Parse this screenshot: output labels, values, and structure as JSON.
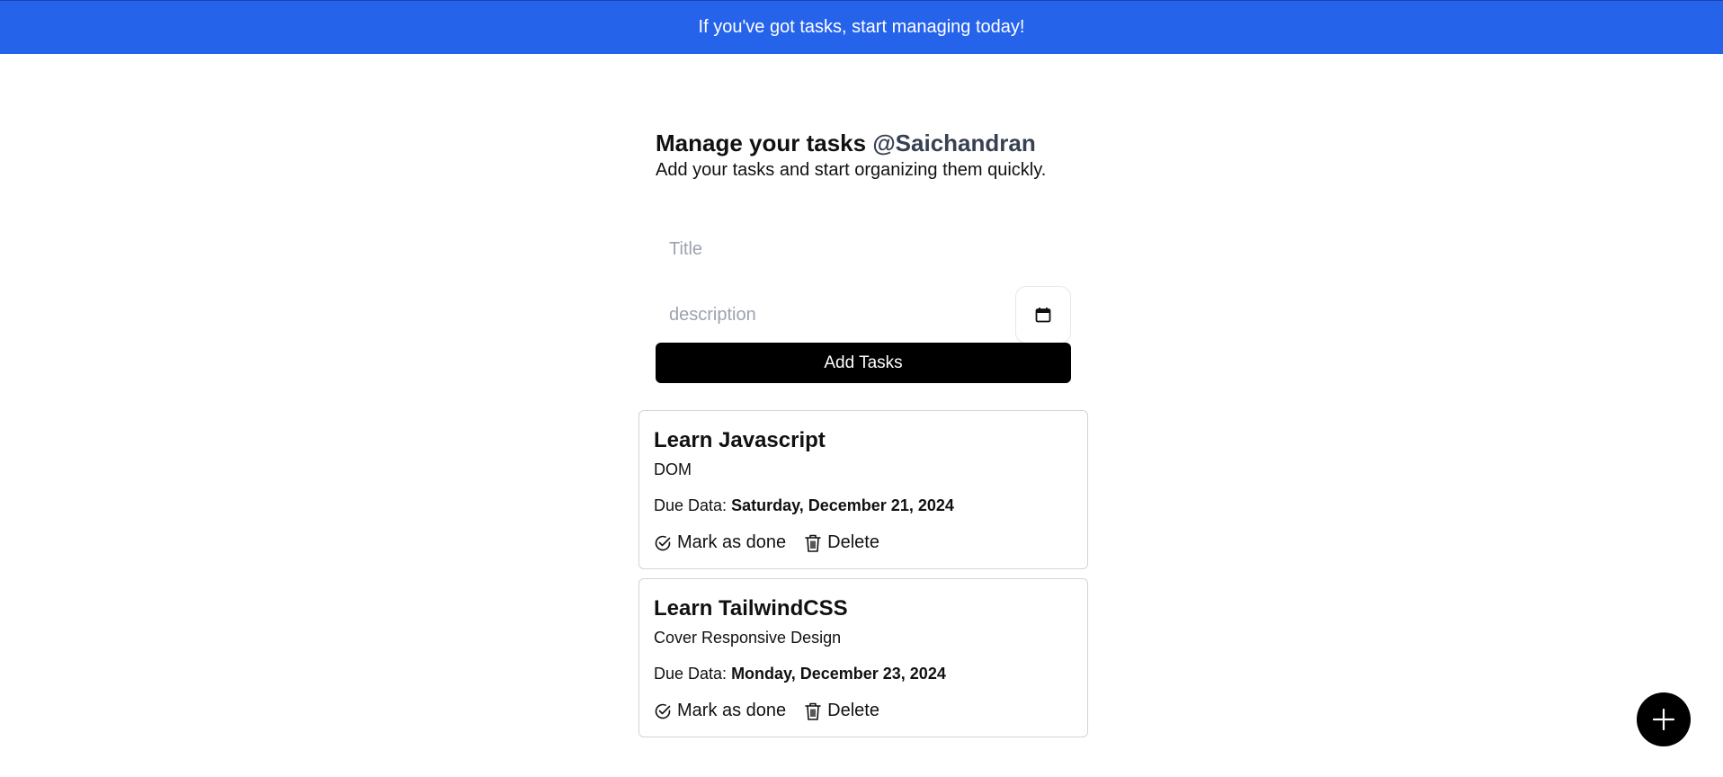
{
  "banner": {
    "text": "If you've got tasks, start managing today!",
    "color": "#2563eb"
  },
  "header": {
    "title": "Manage your tasks",
    "username": "@Saichandran",
    "subtitle": "Add your tasks and start organizing them quickly."
  },
  "form": {
    "title_placeholder": "Title",
    "title_value": "",
    "description_placeholder": "description",
    "description_value": "",
    "date_icon": "calendar-icon",
    "add_button_label": "Add Tasks"
  },
  "tasks": [
    {
      "title": "Learn Javascript",
      "description": "DOM",
      "due_label": "Due Data:",
      "due_value": "Saturday, December 21, 2024",
      "mark_done_label": "Mark as done",
      "delete_label": "Delete"
    },
    {
      "title": "Learn TailwindCSS",
      "description": "Cover Responsive Design",
      "due_label": "Due Data:",
      "due_value": "Monday, December 23, 2024",
      "mark_done_label": "Mark as done",
      "delete_label": "Delete"
    }
  ],
  "fab": {
    "icon": "plus-icon"
  }
}
